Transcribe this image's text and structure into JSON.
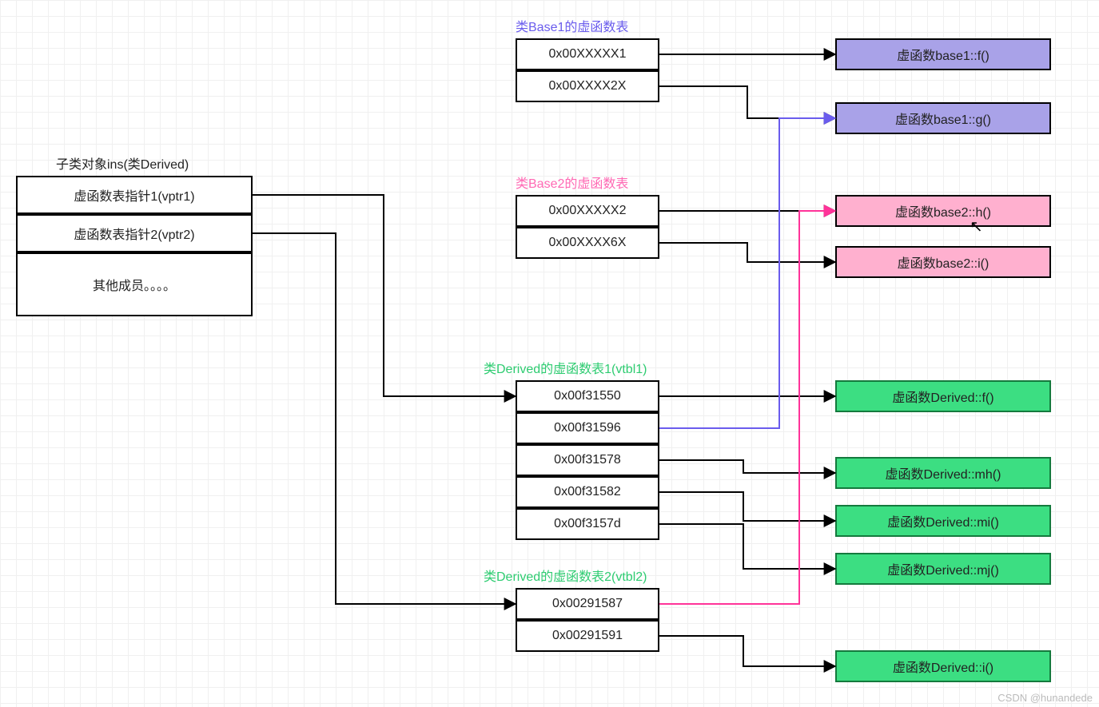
{
  "obj": {
    "title": "子类对象ins(类Derived)",
    "rows": [
      "虚函数表指针1(vptr1)",
      "虚函数表指针2(vptr2)",
      "其他成员。。。。"
    ]
  },
  "base1": {
    "title": "类Base1的虚函数表",
    "rows": [
      "0x00XXXXX1",
      "0x00XXXX2X"
    ]
  },
  "base2": {
    "title": "类Base2的虚函数表",
    "rows": [
      "0x00XXXXX2",
      "0x00XXXX6X"
    ]
  },
  "vtbl1": {
    "title": "类Derived的虚函数表1(vtbl1)",
    "rows": [
      "0x00f31550",
      "0x00f31596",
      "0x00f31578",
      "0x00f31582",
      "0x00f3157d"
    ]
  },
  "vtbl2": {
    "title": "类Derived的虚函数表2(vtbl2)",
    "rows": [
      "0x00291587",
      "0x00291591"
    ]
  },
  "fn": {
    "b1f": "虚函数base1::f()",
    "b1g": "虚函数base1::g()",
    "b2h": "虚函数base2::h()",
    "b2i": "虚函数base2::i()",
    "df": "虚函数Derived::f()",
    "dmh": "虚函数Derived::mh()",
    "dmi": "虚函数Derived::mi()",
    "dmj": "虚函数Derived::mj()",
    "di": "虚函数Derived::i()"
  },
  "watermark": "CSDN @hunandede"
}
